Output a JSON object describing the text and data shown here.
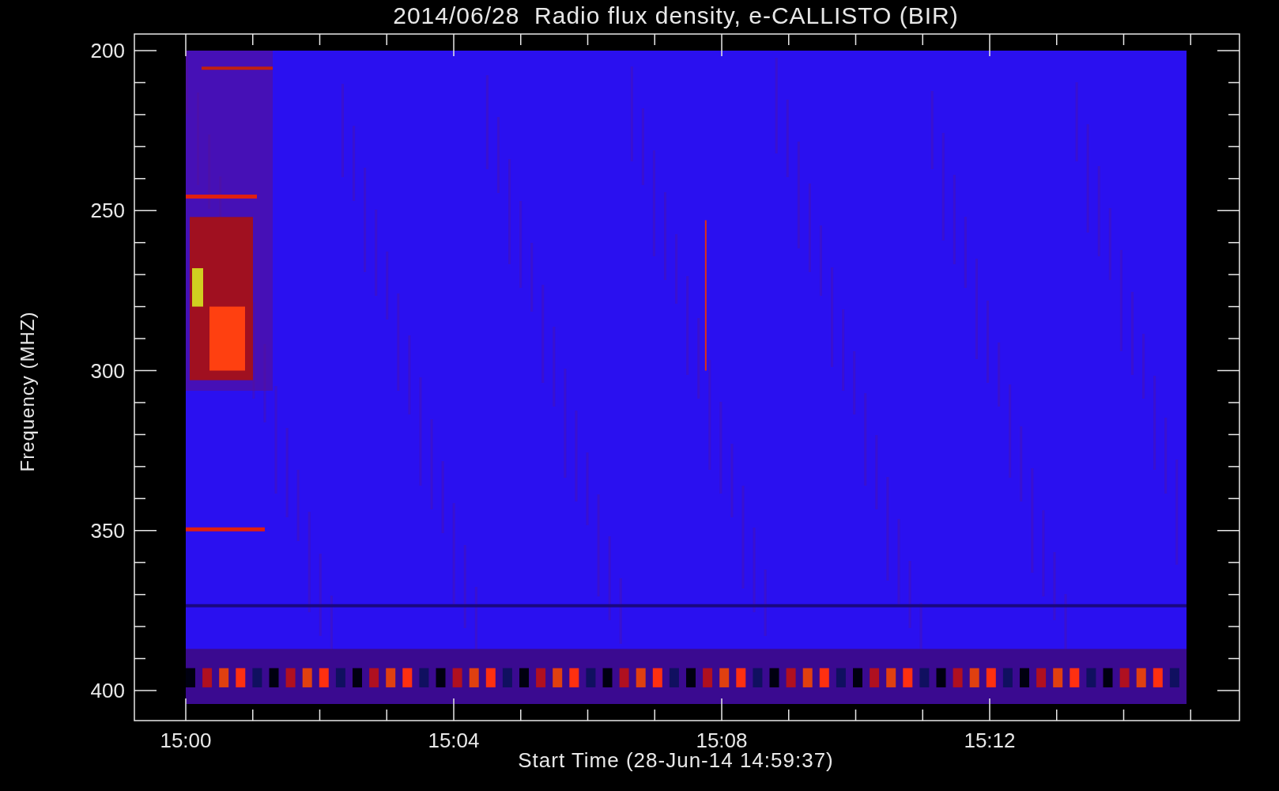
{
  "plot": {
    "title": "2014/06/28  Radio flux density, e-CALLISTO (BIR)",
    "ylabel": "Frequency (MHZ)",
    "xlabel": "Start Time (28-Jun-14 14:59:37)",
    "yticks": [
      "200",
      "250",
      "300",
      "350",
      "400"
    ],
    "xticks": [
      "15:00",
      "15:04",
      "15:08",
      "15:12"
    ]
  }
}
